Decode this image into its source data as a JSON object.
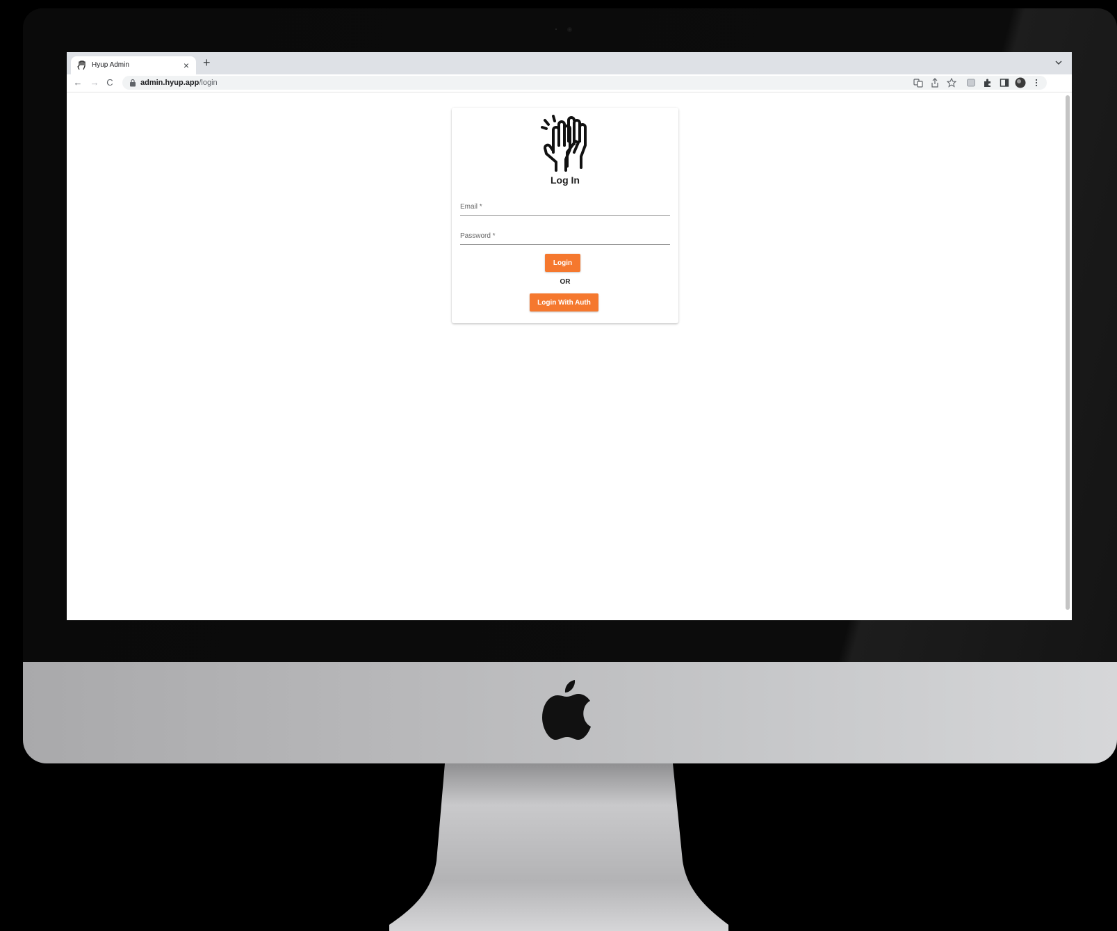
{
  "browser": {
    "tab_title": "Hyup Admin",
    "tab_close": "×",
    "new_tab": "+",
    "url_host": "admin.hyup.app",
    "url_path": "/login",
    "nav": {
      "back": "←",
      "forward": "→",
      "reload": "C"
    },
    "toolbar_icons": [
      "translate-icon",
      "share-icon",
      "bookmark-star-icon",
      "extension-box-icon",
      "puzzle-icon",
      "side-panel-icon",
      "profile-avatar-icon",
      "more-menu-icon"
    ]
  },
  "login": {
    "title": "Log In",
    "email_placeholder": "Email *",
    "password_placeholder": "Password *",
    "login_button": "Login",
    "or_text": "OR",
    "auth_button": "Login With Auth"
  },
  "colors": {
    "accent": "#f5782e",
    "tab_strip": "#dee1e6",
    "omnibox": "#f1f3f4"
  }
}
